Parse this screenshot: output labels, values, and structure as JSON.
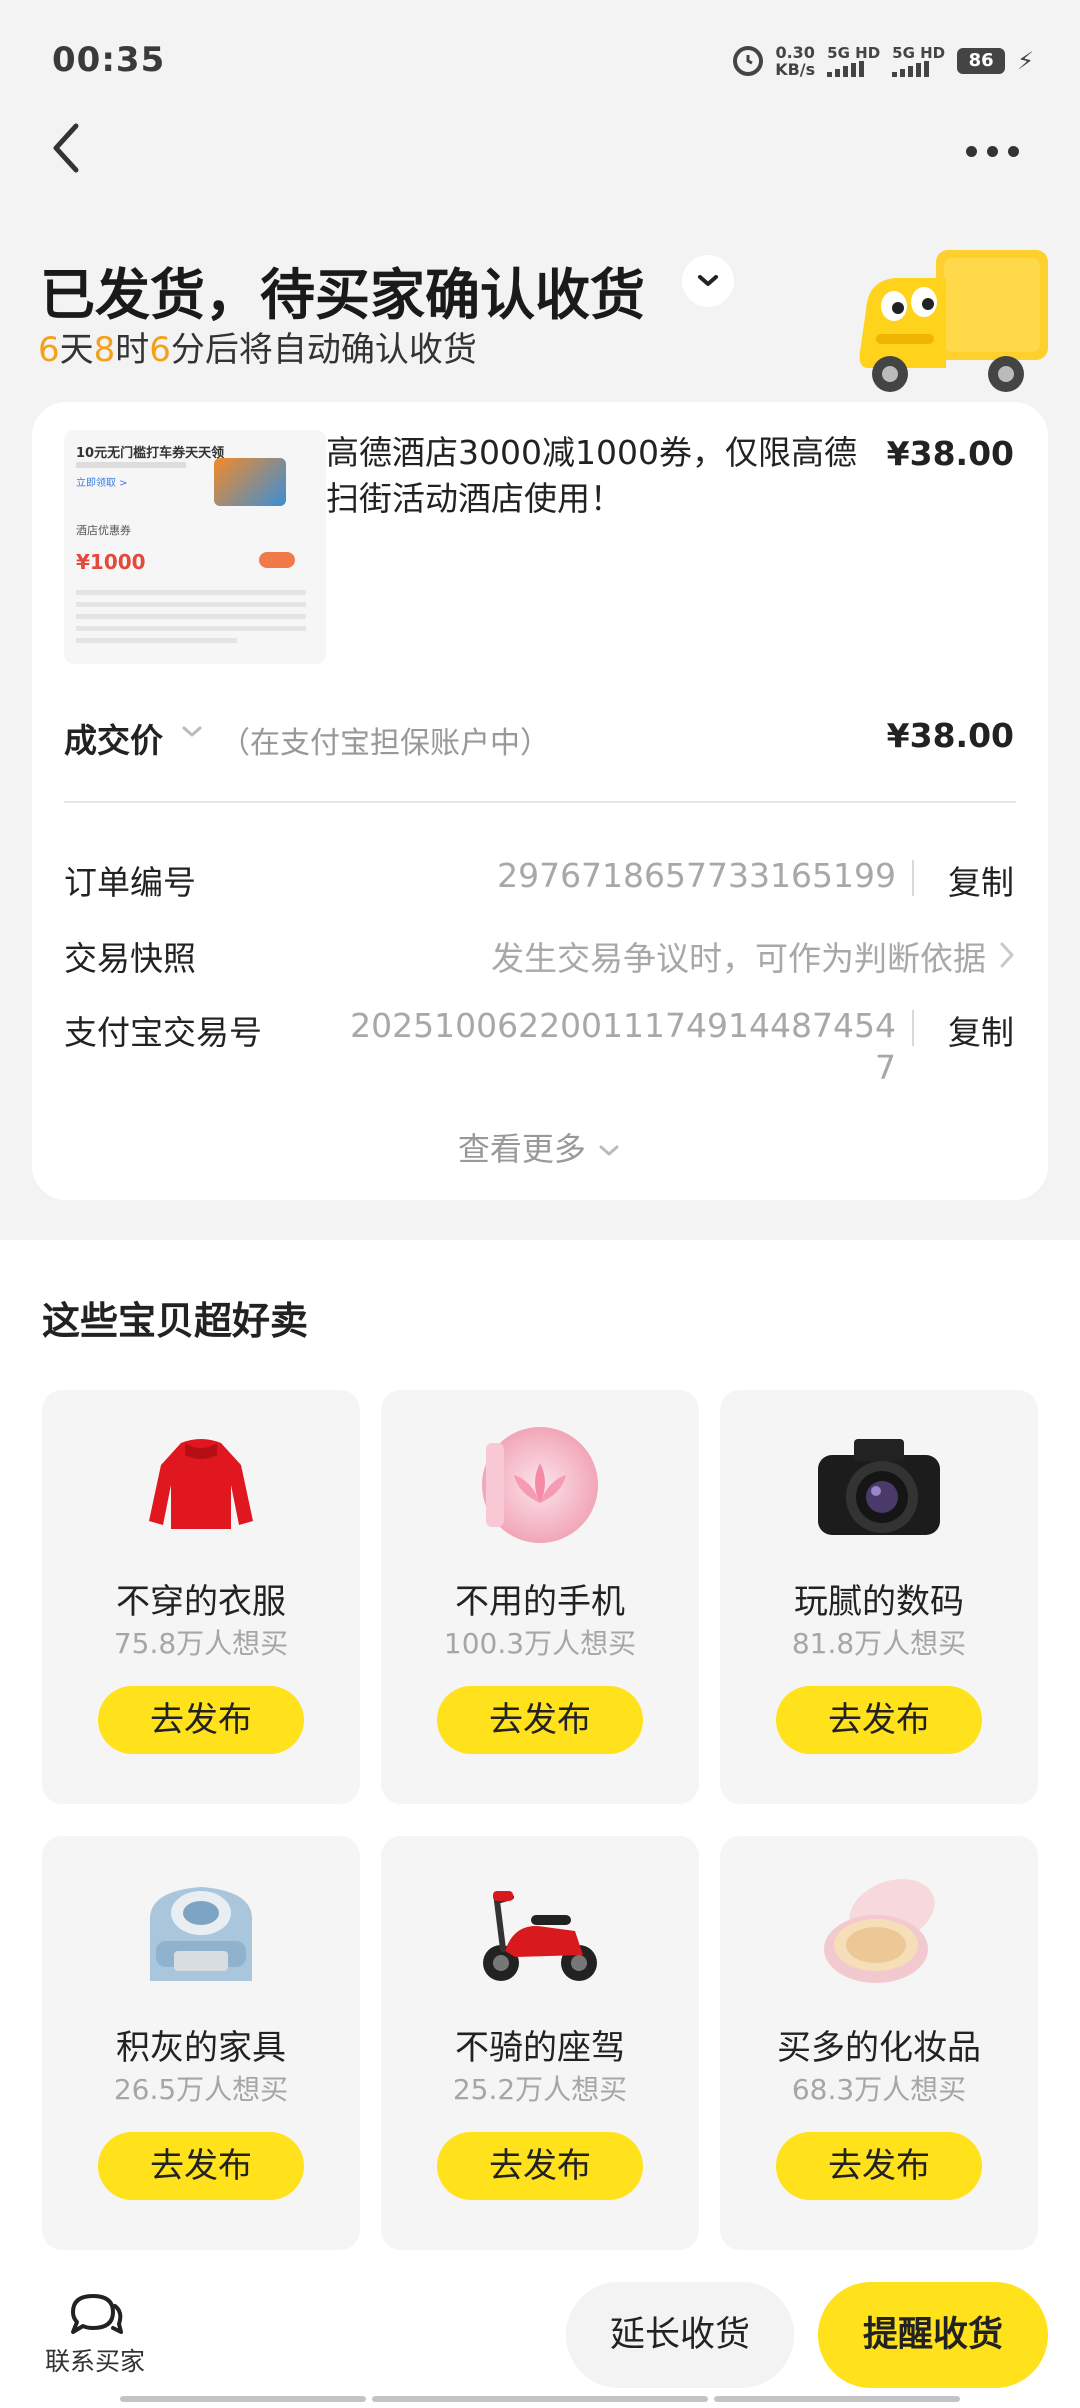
{
  "status_bar": {
    "time": "00:35",
    "net_speed_value": "0.30",
    "net_speed_unit": "KB/s",
    "sim1_label": "5G HD",
    "sim2_label": "5G HD",
    "battery": "86"
  },
  "header": {
    "status_title": "已发货，待买家确认收货",
    "countdown": {
      "days": "6",
      "days_unit": "天",
      "hours": "8",
      "hours_unit": "时",
      "minutes": "6",
      "suffix": "分后将自动确认收货"
    }
  },
  "order": {
    "thumb": {
      "headline": "10元无门槛打车券天天领",
      "link": "立即领取 >",
      "tag": "酒店优惠券",
      "amount": "¥1000"
    },
    "product_title": "高德酒店3000减1000券，仅限高德扫街活动酒店使用！",
    "price": "¥38.00",
    "deal_price_label": "成交价",
    "deal_price_note": "（在支付宝担保账户中）",
    "deal_price": "¥38.00",
    "order_no_label": "订单编号",
    "order_no": "2976718657733165199",
    "copy_label": "复制",
    "snapshot_label": "交易快照",
    "snapshot_value": "发生交易争议时，可作为判断依据",
    "alipay_no_label": "支付宝交易号",
    "alipay_no_line1": "20251006220011174914487454",
    "alipay_no_line2": "7",
    "see_more": "查看更多"
  },
  "recommendations": {
    "title": "这些宝贝超好卖",
    "items": [
      {
        "name": "不穿的衣服",
        "count": "75.8万人想买",
        "button": "去发布",
        "icon": "sweater-icon"
      },
      {
        "name": "不用的手机",
        "count": "100.3万人想买",
        "button": "去发布",
        "icon": "phone-icon"
      },
      {
        "name": "玩腻的数码",
        "count": "81.8万人想买",
        "button": "去发布",
        "icon": "camera-icon"
      },
      {
        "name": "积灰的家具",
        "count": "26.5万人想买",
        "button": "去发布",
        "icon": "armchair-icon"
      },
      {
        "name": "不骑的座驾",
        "count": "25.2万人想买",
        "button": "去发布",
        "icon": "scooter-icon"
      },
      {
        "name": "买多的化妆品",
        "count": "68.3万人想买",
        "button": "去发布",
        "icon": "cushion-compact-icon"
      }
    ]
  },
  "bottom_bar": {
    "contact_label": "联系买家",
    "extend_label": "延长收货",
    "remind_label": "提醒收货"
  },
  "colors": {
    "accent_yellow": "#ffe11c",
    "countdown_orange": "#f5a01a",
    "muted_text": "#a8a8a8"
  }
}
